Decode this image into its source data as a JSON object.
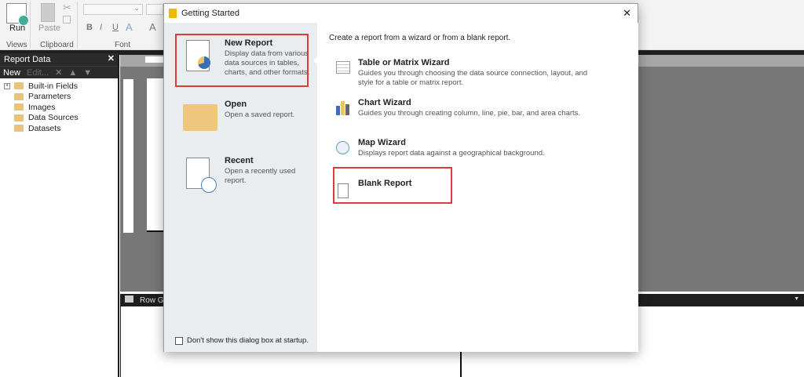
{
  "ribbon": {
    "run": "Run",
    "paste": "Paste",
    "groups": [
      "Views",
      "Clipboard",
      "Font"
    ],
    "bold": "B",
    "italic": "I",
    "underline": "U"
  },
  "report_data": {
    "title": "Report Data",
    "new": "New",
    "edit": "Edit...",
    "items": [
      "Built-in Fields",
      "Parameters",
      "Images",
      "Data Sources",
      "Datasets"
    ]
  },
  "groups_pane": {
    "row_groups": "Row Gro"
  },
  "dialog": {
    "title": "Getting Started",
    "left": [
      {
        "title": "New Report",
        "desc": "Display data from various data sources in tables, charts, and other formats."
      },
      {
        "title": "Open",
        "desc": "Open a saved report."
      },
      {
        "title": "Recent",
        "desc": "Open a recently used report."
      }
    ],
    "checkbox": "Don't show this dialog box at startup.",
    "intro": "Create a report from a wizard or from a blank report.",
    "wizards": [
      {
        "title": "Table or Matrix Wizard",
        "desc": "Guides you through choosing the data source connection, layout, and style for a table or matrix report."
      },
      {
        "title": "Chart Wizard",
        "desc": "Guides you through creating column, line, pie, bar, and area charts."
      },
      {
        "title": "Map Wizard",
        "desc": "Displays report data against a geographical background."
      },
      {
        "title": "Blank Report",
        "desc": ""
      }
    ]
  },
  "colors": {
    "highlight": "#e03b3b",
    "folder": "#e9c27c"
  }
}
